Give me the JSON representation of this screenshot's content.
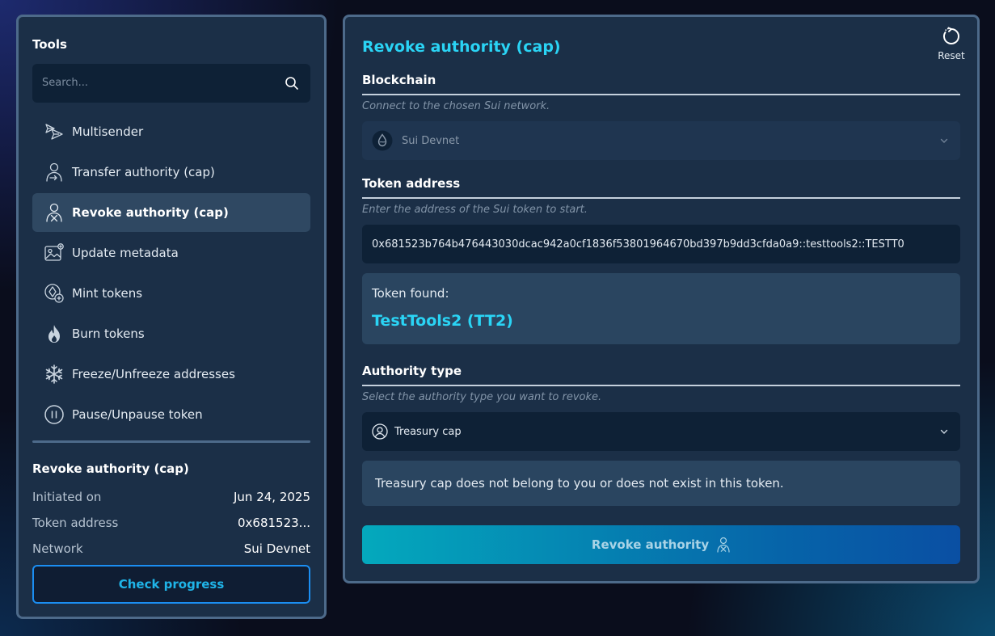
{
  "sidebar": {
    "title": "Tools",
    "search_placeholder": "Search...",
    "items": [
      {
        "label": "Multisender",
        "icon": "multisender-icon",
        "active": false
      },
      {
        "label": "Transfer authority (cap)",
        "icon": "transfer-authority-icon",
        "active": false
      },
      {
        "label": "Revoke authority (cap)",
        "icon": "revoke-authority-icon",
        "active": true
      },
      {
        "label": "Update metadata",
        "icon": "update-metadata-icon",
        "active": false
      },
      {
        "label": "Mint tokens",
        "icon": "mint-tokens-icon",
        "active": false
      },
      {
        "label": "Burn tokens",
        "icon": "flame-icon",
        "active": false
      },
      {
        "label": "Freeze/Unfreeze addresses",
        "icon": "snowflake-icon",
        "active": false
      },
      {
        "label": "Pause/Unpause token",
        "icon": "pause-icon",
        "active": false
      }
    ],
    "summary": {
      "title": "Revoke authority (cap)",
      "rows": [
        {
          "key": "Initiated on",
          "value": "Jun 24, 2025"
        },
        {
          "key": "Token address",
          "value": "0x681523..."
        },
        {
          "key": "Network",
          "value": "Sui Devnet"
        }
      ],
      "button": "Check progress"
    }
  },
  "main": {
    "title": "Revoke authority (cap)",
    "reset_label": "Reset",
    "blockchain": {
      "title": "Blockchain",
      "hint": "Connect to the chosen Sui network.",
      "value": "Sui Devnet"
    },
    "token_address": {
      "title": "Token address",
      "hint": "Enter the address of the Sui token to start.",
      "value": "0x681523b764b476443030dcac942a0cf1836f53801964670bd397b9dd3cfda0a9::testtools2::TESTT0"
    },
    "token_found": {
      "label": "Token found:",
      "name": "TestTools2 (TT2)"
    },
    "authority_type": {
      "title": "Authority type",
      "hint": "Select the authority type you want to revoke.",
      "value": "Treasury cap"
    },
    "message": "Treasury cap does not belong to you or does not exist in this token.",
    "submit_label": "Revoke authority"
  },
  "colors": {
    "accent": "#2ad4f5",
    "panel": "#1b2f47",
    "panel_border": "#4d6a8a",
    "button_gradient_start": "#04a9bd",
    "button_gradient_end": "#0a4fa3"
  }
}
